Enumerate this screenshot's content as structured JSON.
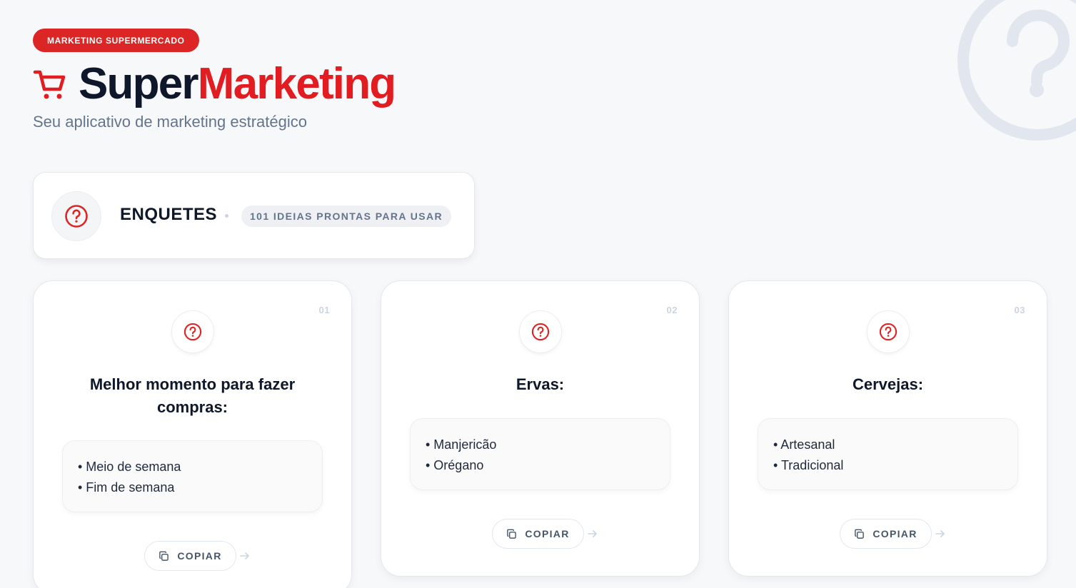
{
  "header": {
    "badge": "MARKETING SUPERMERCADO",
    "brand_part1": "Super",
    "brand_part2": "Marketing",
    "tagline": "Seu aplicativo de marketing estratégico"
  },
  "section": {
    "title": "ENQUETES",
    "pill": "101 IDEIAS PRONTAS PARA USAR"
  },
  "cards": [
    {
      "number": "01",
      "title": "Melhor momento para fazer compras:",
      "options": [
        "• Meio de semana",
        "• Fim de semana"
      ],
      "copy_label": "COPIAR"
    },
    {
      "number": "02",
      "title": "Ervas:",
      "options": [
        "• Manjericão",
        "• Orégano"
      ],
      "copy_label": "COPIAR"
    },
    {
      "number": "03",
      "title": "Cervejas:",
      "options": [
        "• Artesanal",
        "• Tradicional"
      ],
      "copy_label": "COPIAR"
    }
  ],
  "icons": {
    "cart": "shopping-cart-icon",
    "question": "question-circle-icon",
    "copy": "copy-icon",
    "arrow": "arrow-right-icon"
  },
  "colors": {
    "accent": "#e11d22",
    "badge": "#dc2626",
    "text_dark": "#0f172a",
    "text_muted": "#64748b",
    "background": "#f7f8fa"
  }
}
